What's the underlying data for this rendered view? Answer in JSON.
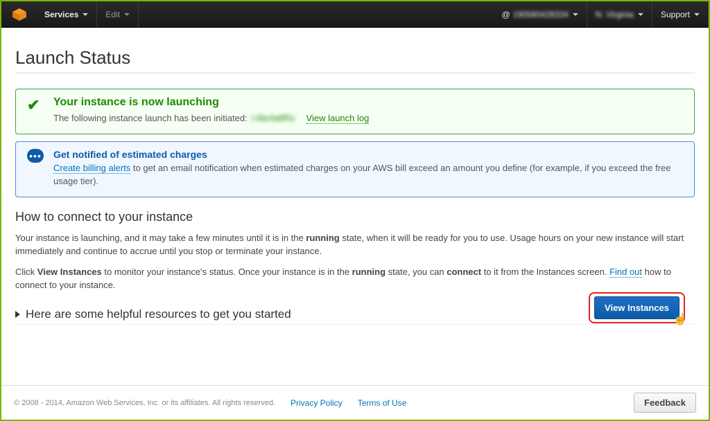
{
  "nav": {
    "services": "Services",
    "edit": "Edit",
    "account_id_masked": "190580428334",
    "region_masked": "N. Virginia",
    "support": "Support"
  },
  "page": {
    "title": "Launch Status"
  },
  "alert_success": {
    "title": "Your instance is now launching",
    "body_prefix": "The following instance launch has been initiated:",
    "instance_id_masked": "i-0bcfa8f5c",
    "view_log": "View launch log"
  },
  "alert_info": {
    "title": "Get notified of estimated charges",
    "create_alerts": "Create billing alerts",
    "body_suffix": " to get an email notification when estimated charges on your AWS bill exceed an amount you define (for example, if you exceed the free usage tier)."
  },
  "connect": {
    "heading": "How to connect to your instance",
    "p1a": "Your instance is launching, and it may take a few minutes until it is in the ",
    "p1_running": "running",
    "p1b": " state, when it will be ready for you to use. Usage hours on your new instance will start immediately and continue to accrue until you stop or terminate your instance.",
    "p2a": "Click ",
    "p2_view": "View Instances",
    "p2b": " to monitor your instance's status. Once your instance is in the ",
    "p2_running": "running",
    "p2c": " state, you can ",
    "p2_connect": "connect",
    "p2d": " to it from the Instances screen. ",
    "findout": "Find out",
    "p2e": " how to connect to your instance."
  },
  "expand": {
    "title": "Here are some helpful resources to get you started"
  },
  "button": {
    "view_instances": "View Instances"
  },
  "footer": {
    "copyright": "© 2008 - 2014, Amazon Web Services, Inc. or its affiliates. All rights reserved.",
    "privacy": "Privacy Policy",
    "terms": "Terms of Use",
    "feedback": "Feedback"
  }
}
